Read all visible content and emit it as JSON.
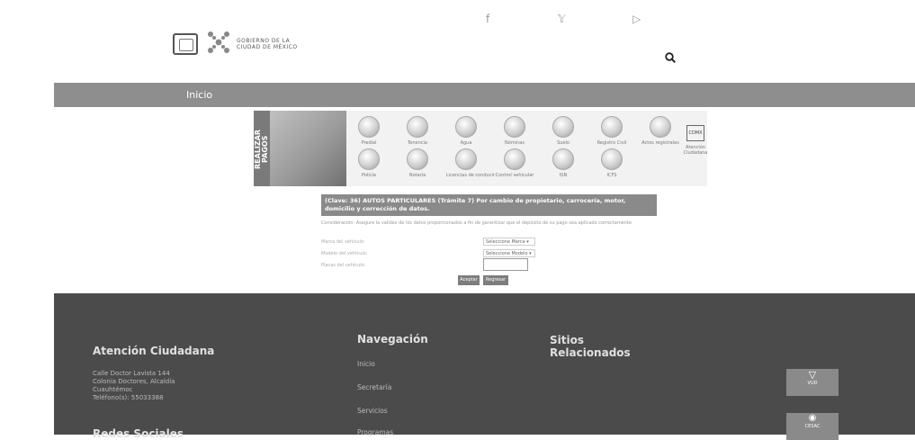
{
  "header": {
    "social": [
      "f",
      "𝕐",
      "▷"
    ],
    "logo_text_line1": "GOBIERNO DE LA",
    "logo_text_line2": "CIUDAD DE MÉXICO"
  },
  "nav": {
    "home": "Inicio"
  },
  "banner": {
    "title": "REALIZAR PAGOS",
    "row1": [
      "Predial",
      "Tenencia",
      "Agua",
      "Nóminas",
      "Suelo",
      "Registro Civil",
      "Actos registrales"
    ],
    "row2": [
      "Policía",
      "Notaría",
      "Licencias de conducir",
      "Control vehicular",
      "ISN",
      "ICFS"
    ],
    "cdmx_label": "CDMX",
    "atencion": [
      "Atención",
      "Ciudadana"
    ]
  },
  "form": {
    "heading": "(Clave: 36) AUTOS PARTICULARES (Trámite 7) Por cambio de propietario, carrocería, motor, domicilio y corrección de datos.",
    "description": "Consideración: Asegure la validez de los datos proporcionados a fin de garantizar que el depósito de su pago sea aplicado correctamente",
    "fields": [
      {
        "label": "Marca del vehículo:",
        "value": "Seleccione Marca"
      },
      {
        "label": "Modelo del vehículo:",
        "value": "Seleccione Modelo"
      },
      {
        "label": "Placas del vehículo:",
        "value": ""
      }
    ],
    "accept_label": "Aceptar",
    "back_label": "Regresar"
  },
  "footer": {
    "atencion_title": "Atención Ciudadana",
    "address": [
      "Calle Doctor Lavista 144",
      "Colonia Doctores, Alcaldía",
      "Cuauhtémoc",
      "Teléfono(s): 55033388"
    ],
    "redes_title": "Redes Sociales",
    "nav_title": "Navegación",
    "nav_links": [
      "Inicio",
      "Secretaría",
      "Servicios",
      "Programas"
    ],
    "sitios_title": "Sitios Relacionados",
    "badge1": "VUD",
    "badge2": "CESAC"
  }
}
